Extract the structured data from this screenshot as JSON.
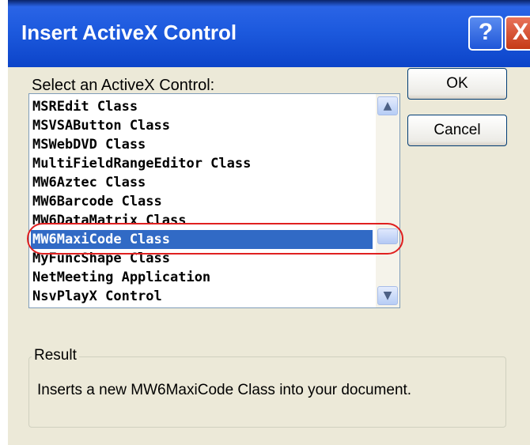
{
  "window": {
    "title": "Insert ActiveX Control",
    "help_label": "?",
    "close_label": "X"
  },
  "prompt": "Select an ActiveX Control:",
  "controls": [
    "MSREdit Class",
    "MSVSAButton Class",
    "MSWebDVD Class",
    "MultiFieldRangeEditor Class",
    "MW6Aztec Class",
    "MW6Barcode Class",
    "MW6DataMatrix Class",
    "MW6MaxiCode Class",
    "MyFuncShape Class",
    "NetMeeting Application",
    "NsvPlayX Control"
  ],
  "selected_control": "MW6MaxiCode Class",
  "buttons": {
    "ok": "OK",
    "cancel": "Cancel"
  },
  "result": {
    "label": "Result",
    "text": "Inserts a new MW6MaxiCode Class into your document."
  },
  "colors": {
    "selection": "#316ac5",
    "highlight_ring": "#e02020",
    "title_bar": "#0c44c9"
  }
}
